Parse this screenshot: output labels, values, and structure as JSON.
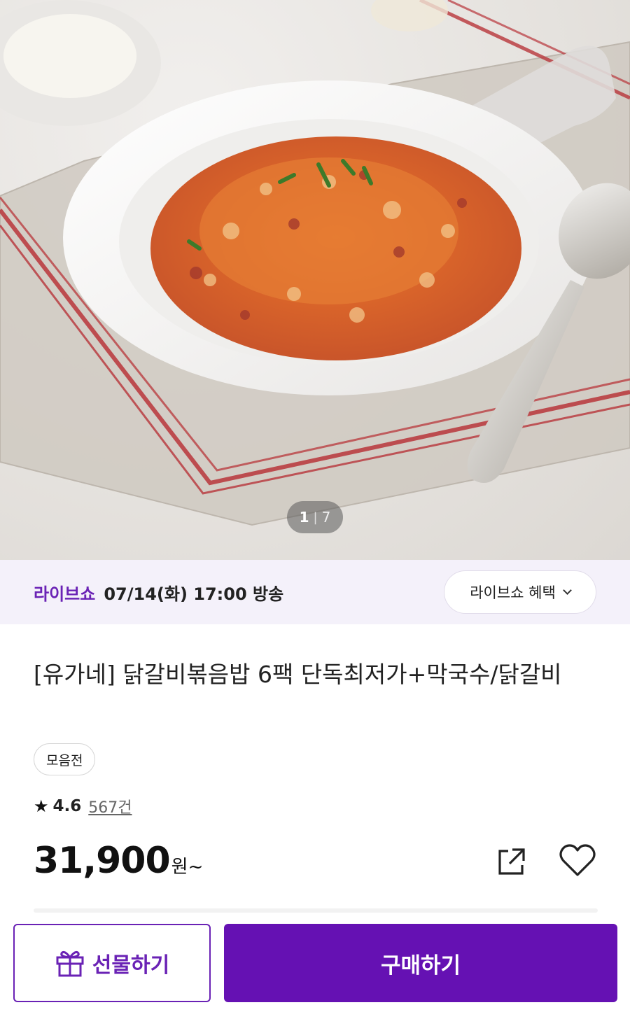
{
  "hero": {
    "image_alt": "닭갈비볶음밥",
    "pager": {
      "current": "1",
      "separator": "|",
      "total": "7"
    }
  },
  "live": {
    "label": "라이브쇼",
    "schedule": "07/14(화) 17:00 방송",
    "benefit_button": "라이브쇼 혜택"
  },
  "product": {
    "title": "[유가네] 닭갈비볶음밥 6팩 단독최저가+막국수/닭갈비",
    "tag": "모음전",
    "rating": {
      "star": "★",
      "score": "4.6",
      "count": "567건"
    },
    "price": {
      "amount": "31,900",
      "unit": "원~"
    }
  },
  "actions": {
    "gift_label": "선물하기",
    "buy_label": "구매하기"
  },
  "colors": {
    "brand_purple": "#6511b3",
    "live_bar_bg": "#f4f1fa",
    "live_label": "#6a22b5"
  },
  "icons": [
    "share-icon",
    "heart-icon",
    "gift-icon",
    "chevron-down-icon",
    "star-icon"
  ]
}
